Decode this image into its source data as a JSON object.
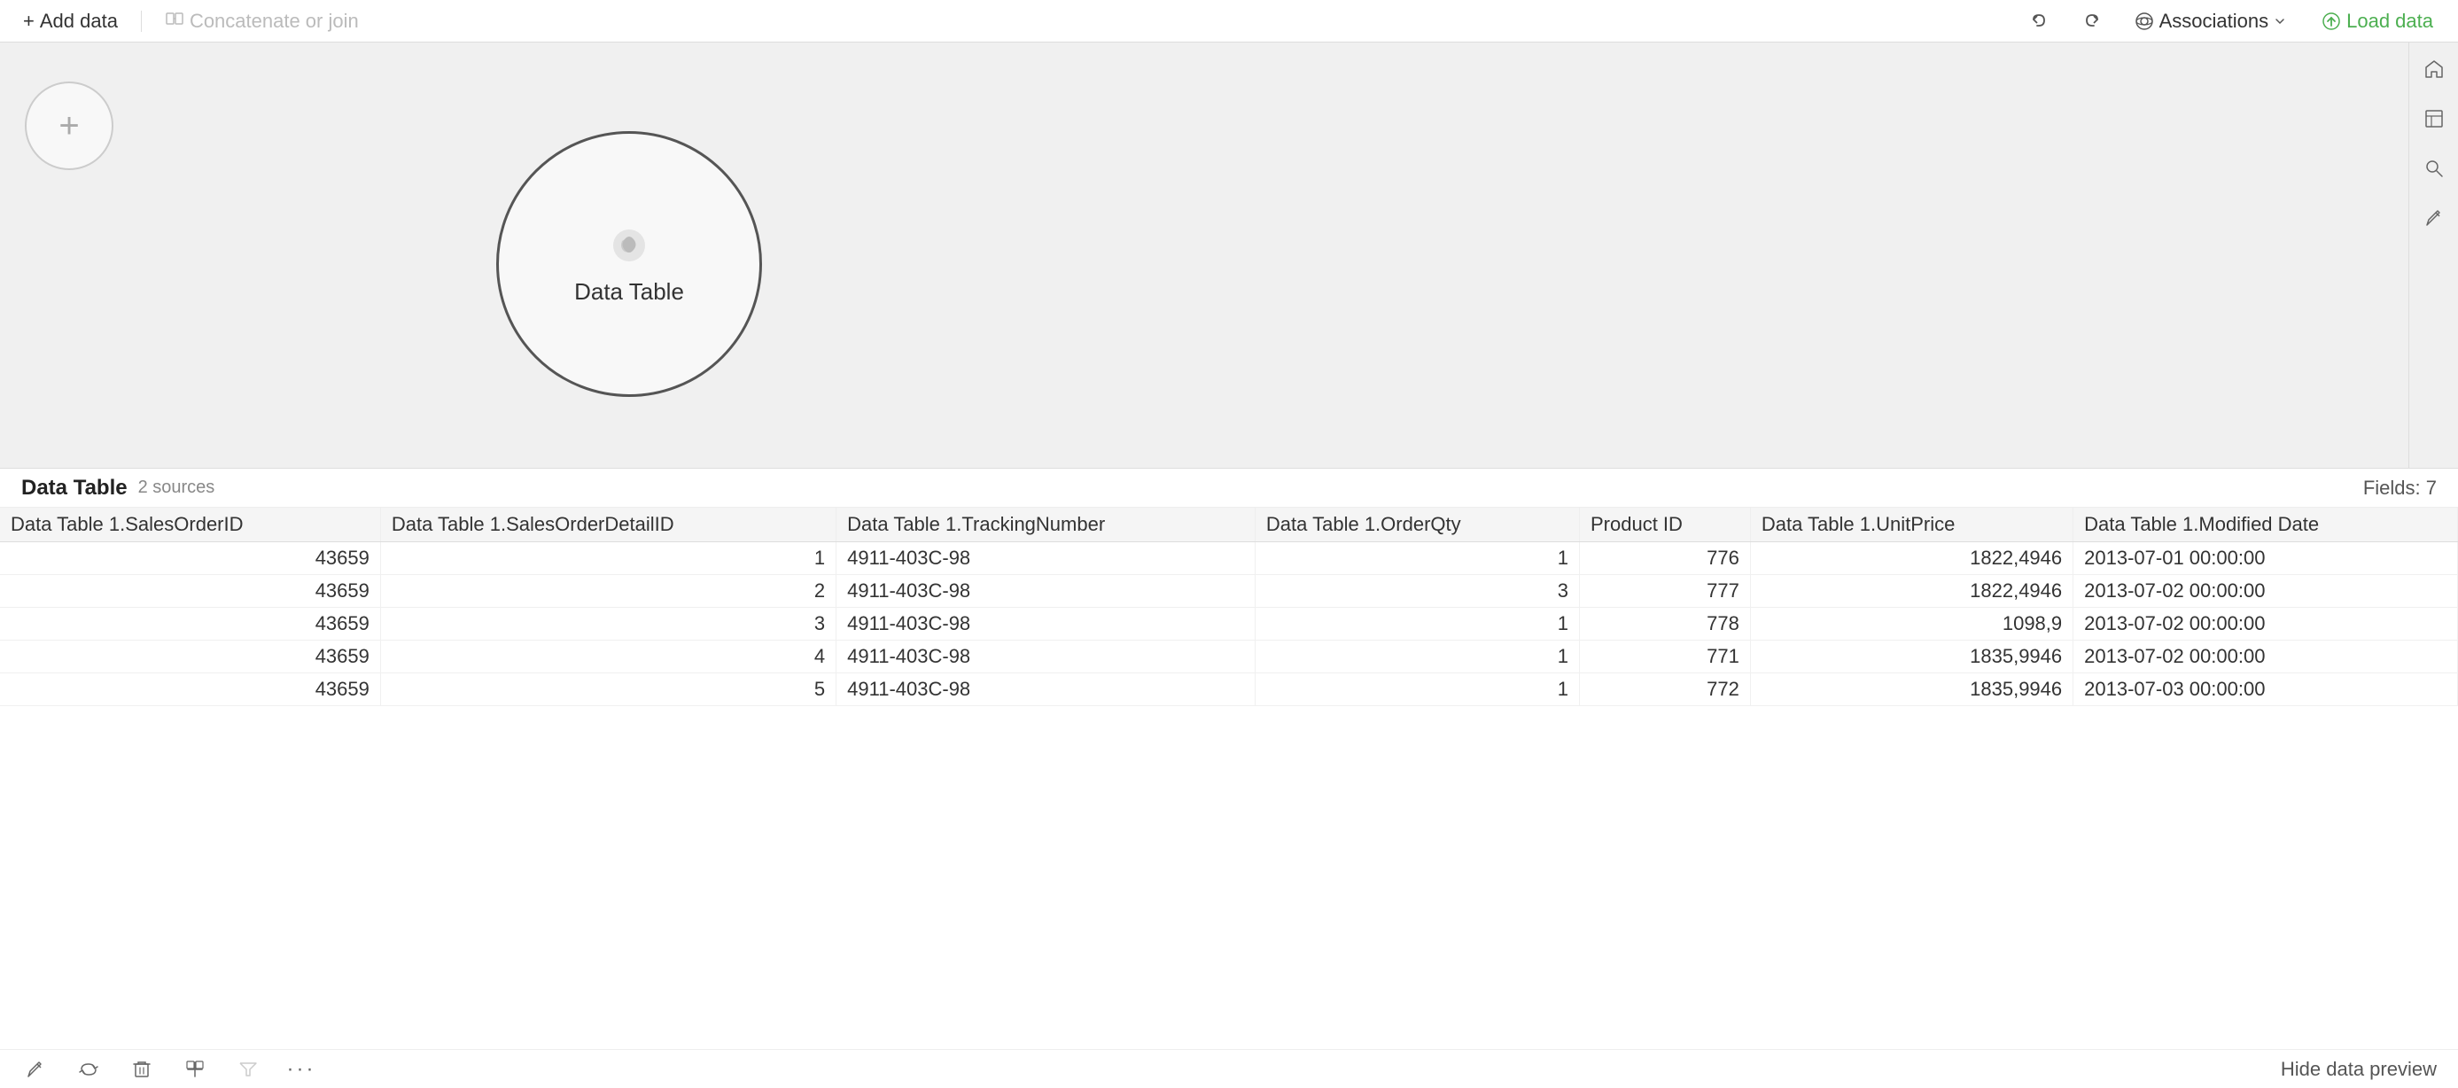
{
  "toolbar": {
    "add_data_label": "Add data",
    "concatenate_join_label": "Concatenate or join",
    "undo_title": "Undo",
    "redo_title": "Redo",
    "associations_label": "Associations",
    "load_data_label": "Load data"
  },
  "canvas": {
    "add_circle_label": "+",
    "data_table_node_label": "Data Table"
  },
  "bottom_panel": {
    "title": "Data Table",
    "sources": "2 sources",
    "fields_label": "Fields: 7",
    "hide_preview_label": "Hide data preview",
    "columns": [
      "Data Table 1.SalesOrderID",
      "Data Table 1.SalesOrderDetailID",
      "Data Table 1.TrackingNumber",
      "Data Table 1.OrderQty",
      "Product ID",
      "Data Table 1.UnitPrice",
      "Data Table 1.Modified Date"
    ],
    "rows": [
      [
        "43659",
        "1",
        "4911-403C-98",
        "1",
        "776",
        "1822,4946",
        "2013-07-01 00:00:00"
      ],
      [
        "43659",
        "2",
        "4911-403C-98",
        "3",
        "777",
        "1822,4946",
        "2013-07-02 00:00:00"
      ],
      [
        "43659",
        "3",
        "4911-403C-98",
        "1",
        "778",
        "1098,9",
        "2013-07-02 00:00:00"
      ],
      [
        "43659",
        "4",
        "4911-403C-98",
        "1",
        "771",
        "1835,9946",
        "2013-07-02 00:00:00"
      ],
      [
        "43659",
        "5",
        "4911-403C-98",
        "1",
        "772",
        "1835,9946",
        "2013-07-03 00:00:00"
      ]
    ]
  }
}
